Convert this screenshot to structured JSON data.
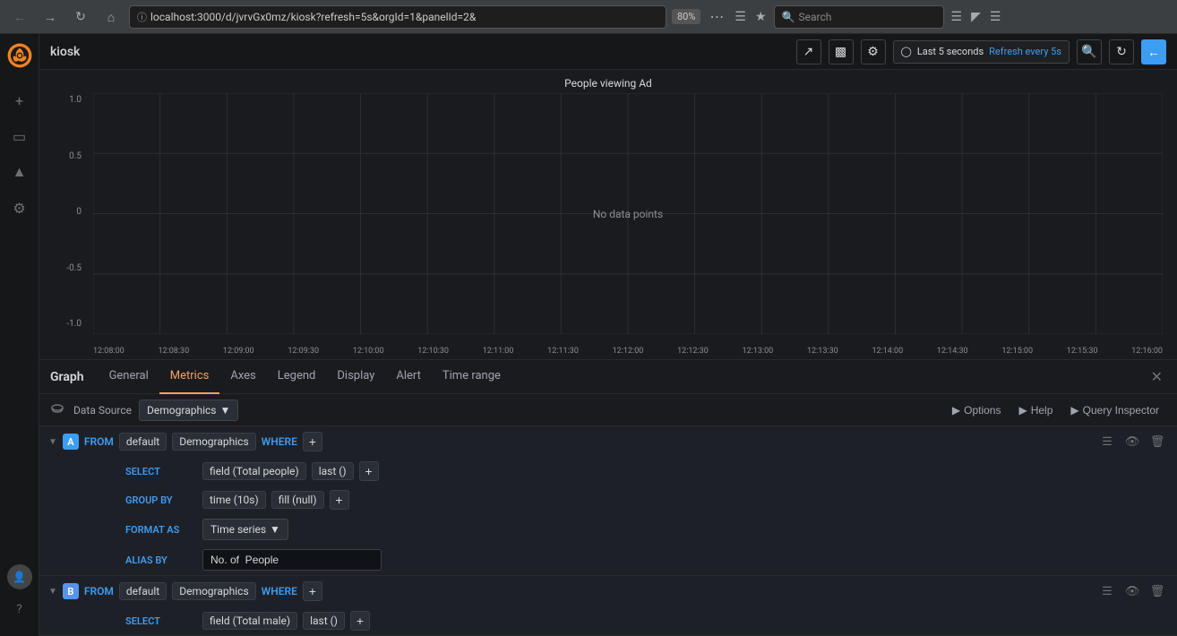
{
  "browser": {
    "back_title": "Back",
    "forward_title": "Forward",
    "reload_title": "Reload",
    "home_title": "Home",
    "url": "localhost:3000/d/jvrvGx0mz/kiosk?refresh=5s&orgId=1&panelId=2&",
    "zoom": "80%",
    "more_title": "More",
    "bookmarks_title": "Bookmarks",
    "star_title": "Star",
    "library_title": "Library",
    "reader_title": "Reader view",
    "search_placeholder": "Search",
    "menu_title": "Menu"
  },
  "topbar": {
    "app_name": "kiosk",
    "share_label": "Share",
    "tv_label": "TV",
    "settings_label": "Settings",
    "time_status": "Last 5 seconds",
    "refresh_label": "Refresh every 5s",
    "search_label": "Search",
    "refresh_title": "Refresh",
    "back_title": "Back"
  },
  "chart": {
    "title": "People viewing Ad",
    "no_data": "No data points",
    "y_labels": [
      "1.0",
      "0.5",
      "0",
      "-0.5",
      "-1.0"
    ],
    "x_labels": [
      "12:08:00",
      "12:08:30",
      "12:09:00",
      "12:09:30",
      "12:10:00",
      "12:10:30",
      "12:11:00",
      "12:11:30",
      "12:12:00",
      "12:12:30",
      "12:13:00",
      "12:13:30",
      "12:14:00",
      "12:14:30",
      "12:15:00",
      "12:15:30",
      "12:16:00"
    ]
  },
  "panel_editor": {
    "title": "Graph",
    "tabs": [
      {
        "label": "General",
        "active": false
      },
      {
        "label": "Metrics",
        "active": true
      },
      {
        "label": "Axes",
        "active": false
      },
      {
        "label": "Legend",
        "active": false
      },
      {
        "label": "Display",
        "active": false
      },
      {
        "label": "Alert",
        "active": false
      },
      {
        "label": "Time range",
        "active": false
      }
    ],
    "close_title": "Close"
  },
  "query_header": {
    "icon_title": "Data source icon",
    "datasource_label": "Data Source",
    "datasource_value": "Demographics",
    "options_label": "Options",
    "help_label": "Help",
    "query_inspector_label": "Query Inspector"
  },
  "query_a": {
    "id": "A",
    "from_keyword": "FROM",
    "from_default": "default",
    "from_table": "Demographics",
    "where_keyword": "WHERE",
    "select_label": "SELECT",
    "select_field": "field (Total people)",
    "select_fn": "last ()",
    "group_label": "GROUP BY",
    "group_time": "time (10s)",
    "group_fill": "fill (null)",
    "format_label": "FORMAT AS",
    "format_value": "Time series",
    "alias_label": "ALIAS BY",
    "alias_value": "No. of  People"
  },
  "query_b": {
    "id": "B",
    "from_keyword": "FROM",
    "from_default": "default",
    "from_table": "Demographics",
    "where_keyword": "WHERE",
    "select_label": "SELECT",
    "select_field": "field (Total male)",
    "select_fn": "last ()"
  },
  "sidebar": {
    "plus_title": "Add",
    "dashboard_title": "Dashboards",
    "bell_title": "Alerting",
    "gear_title": "Configuration",
    "avatar_title": "Profile",
    "help_title": "Help"
  },
  "colors": {
    "accent_blue": "#3d9df2",
    "accent_orange": "#f2a35e",
    "bg_dark": "#111217",
    "bg_panel": "#1a1b1e"
  }
}
